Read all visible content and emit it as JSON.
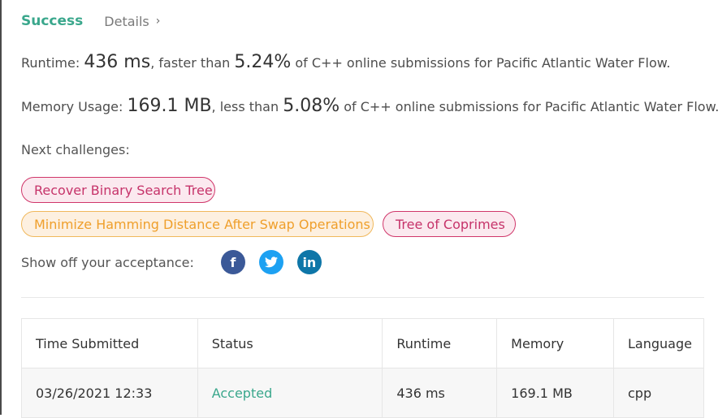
{
  "result": {
    "status_label": "Success",
    "details_label": "Details",
    "details_chevron": "›"
  },
  "runtime": {
    "prefix": "Runtime: ",
    "value": "436 ms",
    "middle": ", faster than ",
    "percent": "5.24%",
    "suffix": " of C++ online submissions for Pacific Atlantic Water Flow."
  },
  "memory": {
    "prefix": "Memory Usage: ",
    "value": "169.1 MB",
    "middle": ", less than ",
    "percent": "5.08%",
    "suffix": " of C++ online submissions for Pacific Atlantic Water Flow."
  },
  "next_challenges": {
    "label": "Next challenges:",
    "items": [
      {
        "title": "Recover Binary Search Tree",
        "difficulty": "hard"
      },
      {
        "title": "Minimize Hamming Distance After Swap Operations",
        "difficulty": "medium"
      },
      {
        "title": "Tree of Coprimes",
        "difficulty": "hard"
      }
    ]
  },
  "share": {
    "label": "Show off your acceptance:",
    "icons": [
      {
        "name": "facebook-icon",
        "glyph": "f"
      },
      {
        "name": "twitter-icon",
        "glyph": "t"
      },
      {
        "name": "linkedin-icon",
        "glyph": "in"
      }
    ]
  },
  "submissions": {
    "columns": [
      "Time Submitted",
      "Status",
      "Runtime",
      "Memory",
      "Language"
    ],
    "rows": [
      {
        "time": "03/26/2021 12:33",
        "status": "Accepted",
        "runtime": "436 ms",
        "memory": "169.1 MB",
        "language": "cpp"
      }
    ]
  },
  "colors": {
    "success": "#3aa78c",
    "hard": "#c6336a",
    "medium": "#ef9f2b",
    "facebook": "#3b5998",
    "twitter": "#1da1f2",
    "linkedin": "#0e76a8"
  }
}
